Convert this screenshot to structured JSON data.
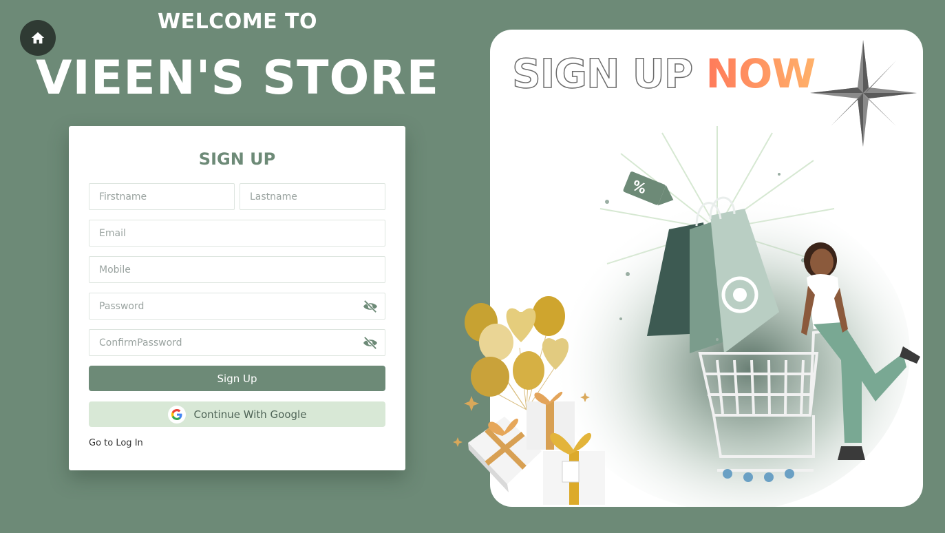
{
  "header": {
    "welcome": "WELCOME TO",
    "store_name": "VIEEN'S STORE"
  },
  "form": {
    "title": "SIGN UP",
    "firstname_placeholder": "Firstname",
    "lastname_placeholder": "Lastname",
    "email_placeholder": "Email",
    "mobile_placeholder": "Mobile",
    "password_placeholder": "Password",
    "confirm_password_placeholder": "ConfirmPassword",
    "signup_label": "Sign Up",
    "google_label": "Continue With Google",
    "login_link": "Go to Log In"
  },
  "promo": {
    "heading_outline": "SIGN UP",
    "heading_highlight": "NOW",
    "badge": "%"
  },
  "colors": {
    "background": "#6d8a77",
    "accent": "#6d8a77",
    "google_button": "#d8e8d6",
    "highlight": "#ff8a5e"
  }
}
